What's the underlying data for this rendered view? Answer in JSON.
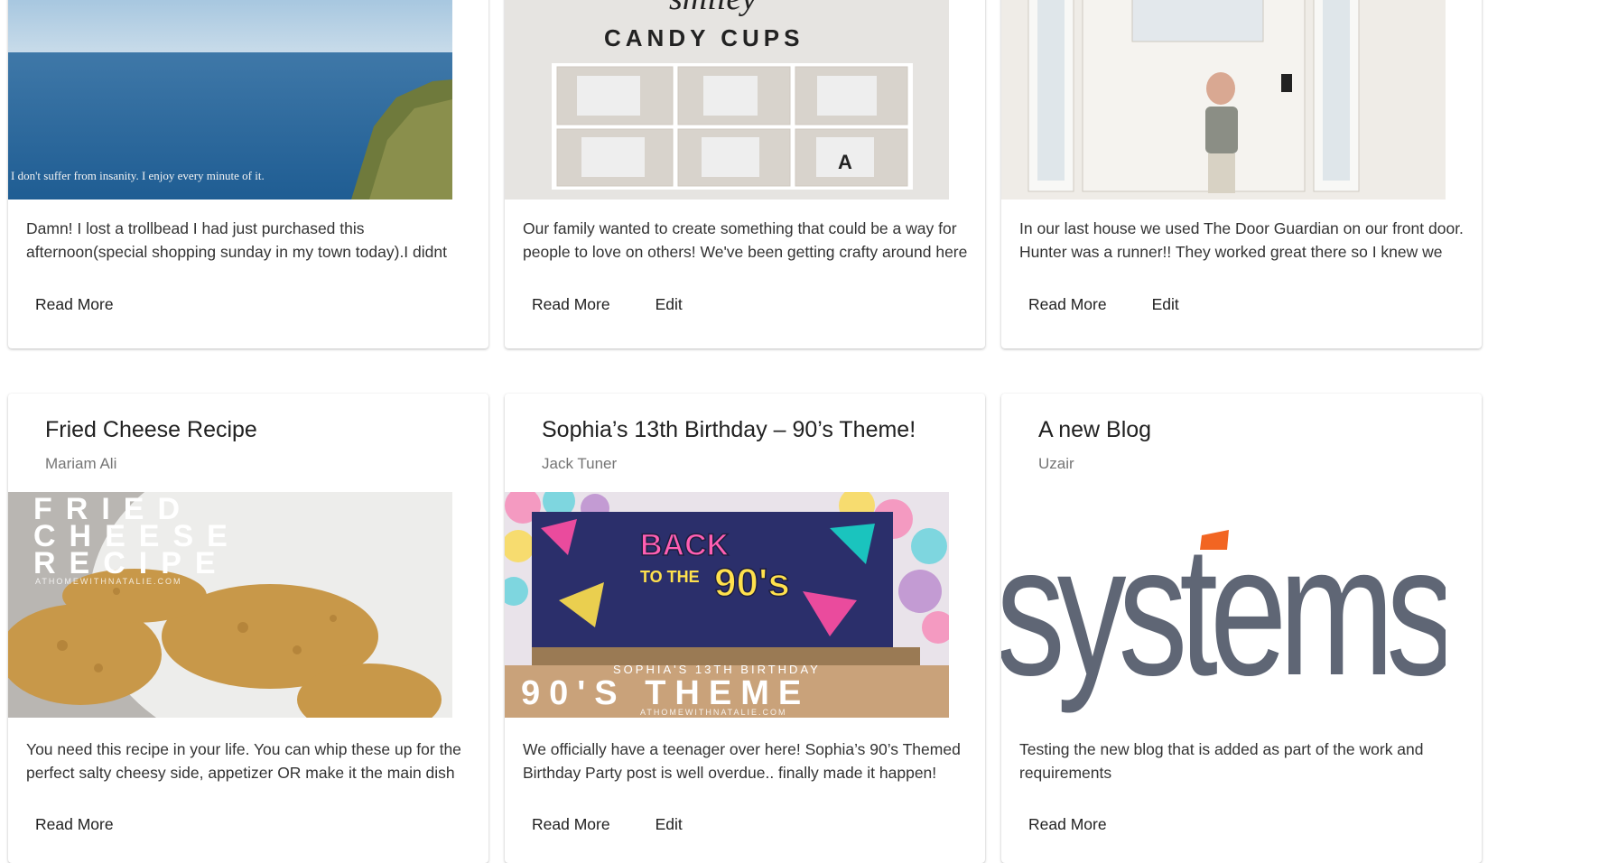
{
  "top_cards": [
    {
      "excerpt": "Damn! I lost a trollbead I had just purchased this afternoon(special shopping sunday in my town today).I didnt",
      "image_caption": "I don't suffer from insanity. I enjoy every minute of it.",
      "read_more": "Read More"
    },
    {
      "excerpt": "Our family wanted to create something that could be a way for people to love on others! We've been getting crafty around here",
      "image_title_script": "smiley",
      "image_title": "CANDY CUPS",
      "read_more": "Read More",
      "edit": "Edit"
    },
    {
      "excerpt": "In our last house we used The Door Guardian on our front door. Hunter was a runner!! They worked great there so I knew we",
      "read_more": "Read More",
      "edit": "Edit"
    }
  ],
  "bottom_cards": [
    {
      "title": "Fried Cheese Recipe",
      "author": "Mariam Ali",
      "image_lines": [
        "FRIED",
        "CHEESE",
        "RECIPE"
      ],
      "image_site": "ATHOMEWITHNATALIE.COM",
      "excerpt": "You need this recipe in your life. You can whip these up for the perfect salty cheesy side, appetizer OR make it the main dish",
      "read_more": "Read More"
    },
    {
      "title": "Sophia’s 13th Birthday – 90’s Theme!",
      "author": "Jack Tuner",
      "image_banner_top": "BACK",
      "image_banner_mid": "TO THE",
      "image_banner_big": "90's",
      "image_subtitle": "SOPHIA'S 13TH BIRTHDAY",
      "image_title": "90'S THEME",
      "image_site": "ATHOMEWITHNATALIE.COM",
      "excerpt": "We officially have a teenager over here! Sophia’s 90’s Themed Birthday Party post is well overdue.. finally made it happen! Ben",
      "read_more": "Read More",
      "edit": "Edit"
    },
    {
      "title": "A new Blog",
      "author": "Uzair",
      "image_word": "systems",
      "excerpt": "Testing the new blog that is added as part of the work and requirements",
      "read_more": "Read More"
    }
  ],
  "colors": {
    "systems_gray": "#5f6675",
    "systems_accent": "#f26522"
  }
}
